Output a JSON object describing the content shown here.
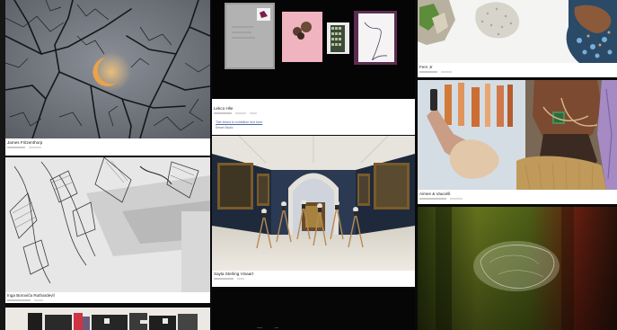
{
  "captions": {
    "card_1": "James Fritzenthorp",
    "card_2": "Inga Boroviča Ruthardevil",
    "card_4": "Lekco Hlie",
    "card_4_link": "Title linked to exhibition text here",
    "card_4_note": "Dream Studio",
    "card_5": "Sayla Sterling Vinaart",
    "card_7": "Fern Jr",
    "card_8": "Aimee & Vaucelli"
  },
  "colors": {
    "background": "#0a0a0a",
    "card": "#ffffff",
    "caption_text": "#222222",
    "meta_bar": "#c9c9c9",
    "link": "#4b63a8"
  }
}
